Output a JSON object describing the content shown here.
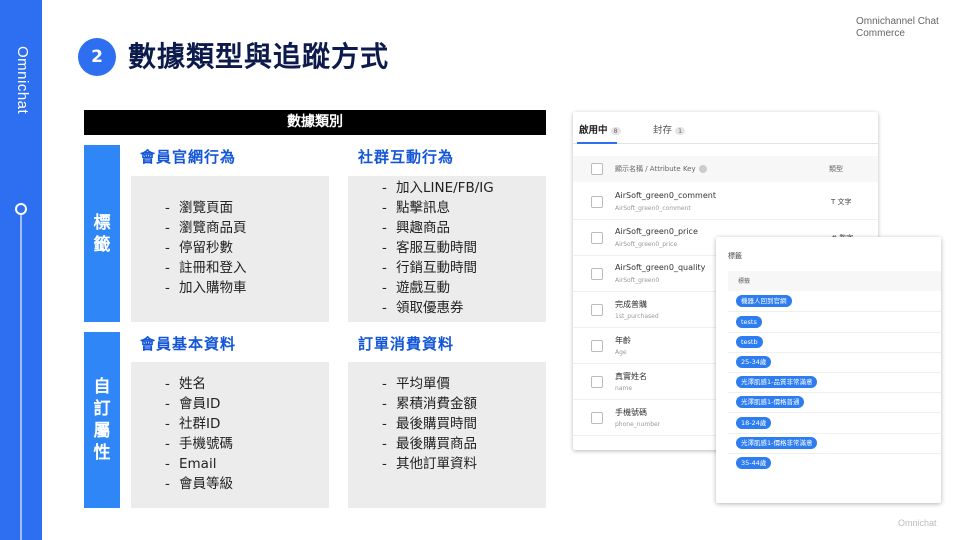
{
  "brand": {
    "vertical": "Omnichat",
    "corner": "Omnichannel Chat Commerce",
    "footer": "Omnichat"
  },
  "header": {
    "number": "2",
    "title": "數據類型與追蹤方式"
  },
  "table": {
    "category_header": "數據類別",
    "rows": [
      {
        "label": [
          "標",
          "籤"
        ]
      },
      {
        "label": [
          "自",
          "訂",
          "屬",
          "性"
        ]
      }
    ],
    "groups": [
      {
        "title": "會員官網行為",
        "items": [
          "瀏覽頁面",
          "瀏覽商品頁",
          "停留秒數",
          "註冊和登入",
          "加入購物車"
        ]
      },
      {
        "title": "社群互動行為",
        "items": [
          "加入LINE/FB/IG",
          "點擊訊息",
          "興趣商品",
          "客服互動時間",
          "行銷互動時間",
          "遊戲互動",
          "領取優惠券"
        ]
      },
      {
        "title": "會員基本資料",
        "items": [
          "姓名",
          "會員ID",
          "社群ID",
          "手機號碼",
          "Email",
          "會員等級"
        ]
      },
      {
        "title": "訂單消費資料",
        "items": [
          "平均單價",
          "累積消費金額",
          "最後購買時間",
          "最後購買商品",
          "其他訂單資料"
        ]
      }
    ]
  },
  "attributes_panel": {
    "tabs": [
      {
        "label": "啟用中",
        "count": "8"
      },
      {
        "label": "封存",
        "count": "1"
      }
    ],
    "columns": {
      "name": "顯示名稱 / Attribute Key",
      "type": "類型"
    },
    "rows": [
      {
        "name": "AirSoft_green0_comment",
        "key": "AirSoft_green0_comment",
        "type": "文字"
      },
      {
        "name": "AirSoft_green0_price",
        "key": "AirSoft_green0_price",
        "type": "數字"
      },
      {
        "name": "AirSoft_green0_quality",
        "key": "AirSoft_green0",
        "type": ""
      },
      {
        "name": "完成普購",
        "key": "1st_purchased",
        "type": ""
      },
      {
        "name": "年齡",
        "key": "Age",
        "type": ""
      },
      {
        "name": "真實姓名",
        "key": "name",
        "type": ""
      },
      {
        "name": "手機號碼",
        "key": "phone_number",
        "type": ""
      }
    ]
  },
  "tags_panel": {
    "title": "標籤",
    "column": "標籤",
    "chips": [
      "機器人回到官網",
      "tests",
      "testb",
      "25-34歲",
      "光澤肌感1-品質非常滿意",
      "光澤肌感1-價格普通",
      "18-24歲",
      "光澤肌感1-價格非常滿意",
      "35-44歲"
    ]
  },
  "colors": {
    "accent": "#2d6ff0",
    "row_label": "#2f86f6",
    "group_title": "#1456d8",
    "chip": "#2d7cf0"
  }
}
